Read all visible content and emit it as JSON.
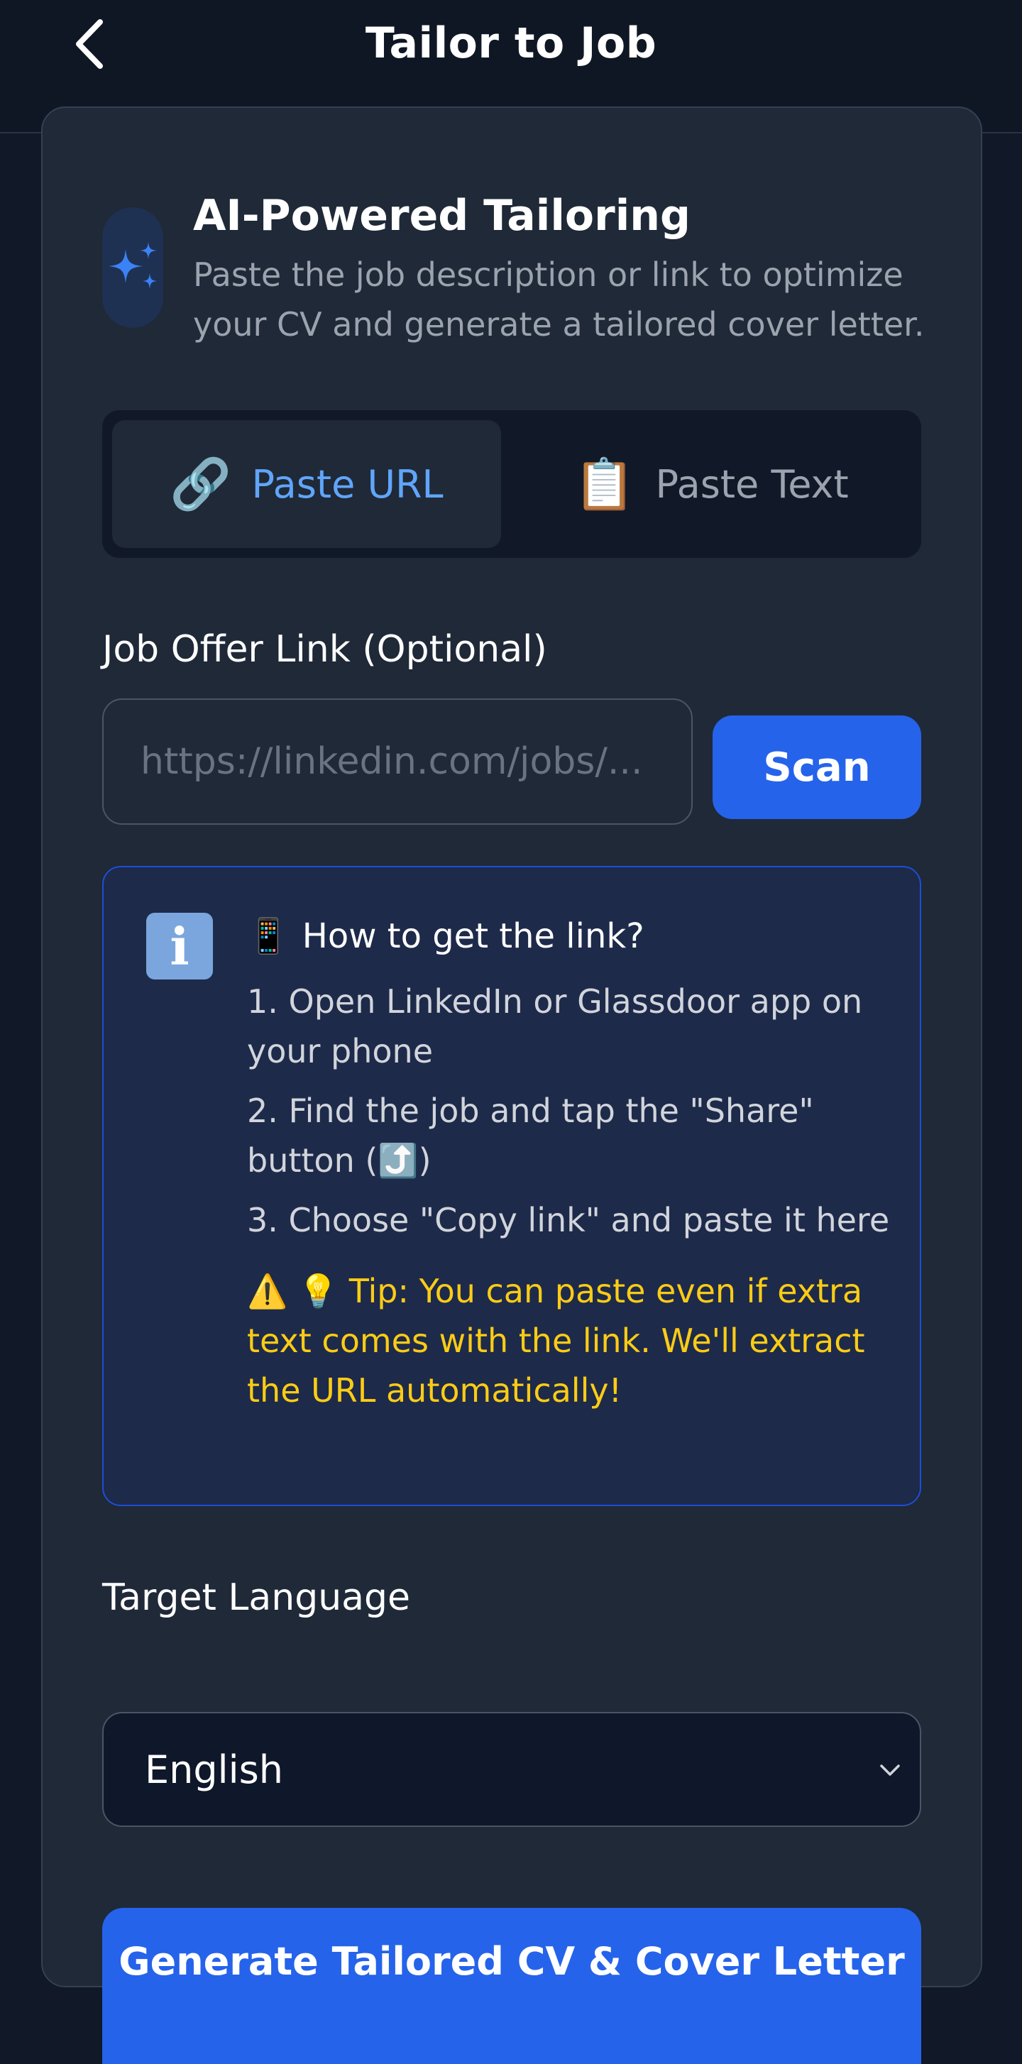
{
  "header": {
    "title": "Tailor to Job",
    "back_icon": "chevron-left-icon"
  },
  "intro": {
    "icon": "sparkles-icon",
    "title": "AI-Powered Tailoring",
    "description": "Paste the job description or link to optimize your CV and generate a tailored cover letter."
  },
  "mode_tabs": [
    {
      "label": "Paste URL",
      "emoji": "🔗",
      "active": true
    },
    {
      "label": "Paste Text",
      "emoji": "📋",
      "active": false
    }
  ],
  "link_field": {
    "label": "Job Offer Link (Optional)",
    "placeholder": "https://linkedin.com/jobs/...",
    "value": "",
    "scan_label": "Scan"
  },
  "help": {
    "badge": "i",
    "heading_emoji": "📱",
    "heading": "How to get the link?",
    "steps": [
      "1. Open LinkedIn or Glassdoor app on your phone",
      "2. Find the job and tap the \"Share\" button (⤴️)",
      "3. Choose \"Copy link\" and paste it here"
    ],
    "tip": "⚠️ 💡 Tip: You can paste even if extra text comes with the link. We'll extract the URL automatically!"
  },
  "language": {
    "label": "Target Language",
    "selected": "English"
  },
  "generate": {
    "label": "Generate Tailored CV & Cover Letter"
  },
  "colors": {
    "background": "#111827",
    "card": "#1f2937",
    "accent": "#2563eb",
    "active_tab_text": "#60a5fa",
    "tip_text": "#facc15",
    "info_background": "#1e2a4a"
  }
}
